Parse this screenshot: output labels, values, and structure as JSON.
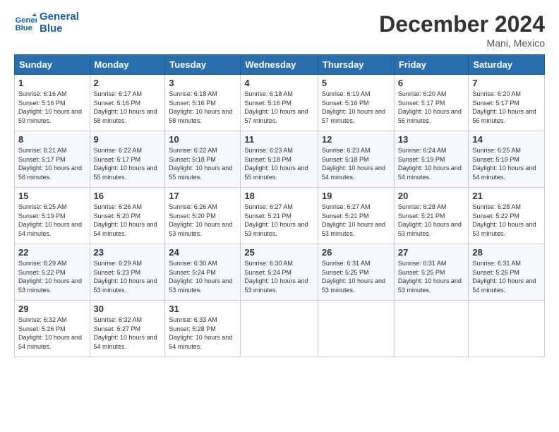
{
  "logo": {
    "line1": "General",
    "line2": "Blue"
  },
  "title": "December 2024",
  "location": "Mani, Mexico",
  "days_header": [
    "Sunday",
    "Monday",
    "Tuesday",
    "Wednesday",
    "Thursday",
    "Friday",
    "Saturday"
  ],
  "weeks": [
    [
      {
        "day": "1",
        "sunrise": "6:16 AM",
        "sunset": "5:16 PM",
        "daylight": "10 hours and 59 minutes."
      },
      {
        "day": "2",
        "sunrise": "6:17 AM",
        "sunset": "5:16 PM",
        "daylight": "10 hours and 58 minutes."
      },
      {
        "day": "3",
        "sunrise": "6:18 AM",
        "sunset": "5:16 PM",
        "daylight": "10 hours and 58 minutes."
      },
      {
        "day": "4",
        "sunrise": "6:18 AM",
        "sunset": "5:16 PM",
        "daylight": "10 hours and 57 minutes."
      },
      {
        "day": "5",
        "sunrise": "6:19 AM",
        "sunset": "5:16 PM",
        "daylight": "10 hours and 57 minutes."
      },
      {
        "day": "6",
        "sunrise": "6:20 AM",
        "sunset": "5:17 PM",
        "daylight": "10 hours and 56 minutes."
      },
      {
        "day": "7",
        "sunrise": "6:20 AM",
        "sunset": "5:17 PM",
        "daylight": "10 hours and 56 minutes."
      }
    ],
    [
      {
        "day": "8",
        "sunrise": "6:21 AM",
        "sunset": "5:17 PM",
        "daylight": "10 hours and 56 minutes."
      },
      {
        "day": "9",
        "sunrise": "6:22 AM",
        "sunset": "5:17 PM",
        "daylight": "10 hours and 55 minutes."
      },
      {
        "day": "10",
        "sunrise": "6:22 AM",
        "sunset": "5:18 PM",
        "daylight": "10 hours and 55 minutes."
      },
      {
        "day": "11",
        "sunrise": "6:23 AM",
        "sunset": "5:18 PM",
        "daylight": "10 hours and 55 minutes."
      },
      {
        "day": "12",
        "sunrise": "6:23 AM",
        "sunset": "5:18 PM",
        "daylight": "10 hours and 54 minutes."
      },
      {
        "day": "13",
        "sunrise": "6:24 AM",
        "sunset": "5:19 PM",
        "daylight": "10 hours and 54 minutes."
      },
      {
        "day": "14",
        "sunrise": "6:25 AM",
        "sunset": "5:19 PM",
        "daylight": "10 hours and 54 minutes."
      }
    ],
    [
      {
        "day": "15",
        "sunrise": "6:25 AM",
        "sunset": "5:19 PM",
        "daylight": "10 hours and 54 minutes."
      },
      {
        "day": "16",
        "sunrise": "6:26 AM",
        "sunset": "5:20 PM",
        "daylight": "10 hours and 54 minutes."
      },
      {
        "day": "17",
        "sunrise": "6:26 AM",
        "sunset": "5:20 PM",
        "daylight": "10 hours and 53 minutes."
      },
      {
        "day": "18",
        "sunrise": "6:27 AM",
        "sunset": "5:21 PM",
        "daylight": "10 hours and 53 minutes."
      },
      {
        "day": "19",
        "sunrise": "6:27 AM",
        "sunset": "5:21 PM",
        "daylight": "10 hours and 53 minutes."
      },
      {
        "day": "20",
        "sunrise": "6:28 AM",
        "sunset": "5:21 PM",
        "daylight": "10 hours and 53 minutes."
      },
      {
        "day": "21",
        "sunrise": "6:28 AM",
        "sunset": "5:22 PM",
        "daylight": "10 hours and 53 minutes."
      }
    ],
    [
      {
        "day": "22",
        "sunrise": "6:29 AM",
        "sunset": "5:22 PM",
        "daylight": "10 hours and 53 minutes."
      },
      {
        "day": "23",
        "sunrise": "6:29 AM",
        "sunset": "5:23 PM",
        "daylight": "10 hours and 53 minutes."
      },
      {
        "day": "24",
        "sunrise": "6:30 AM",
        "sunset": "5:24 PM",
        "daylight": "10 hours and 53 minutes."
      },
      {
        "day": "25",
        "sunrise": "6:30 AM",
        "sunset": "5:24 PM",
        "daylight": "10 hours and 53 minutes."
      },
      {
        "day": "26",
        "sunrise": "6:31 AM",
        "sunset": "5:25 PM",
        "daylight": "10 hours and 53 minutes."
      },
      {
        "day": "27",
        "sunrise": "6:31 AM",
        "sunset": "5:25 PM",
        "daylight": "10 hours and 53 minutes."
      },
      {
        "day": "28",
        "sunrise": "6:31 AM",
        "sunset": "5:26 PM",
        "daylight": "10 hours and 54 minutes."
      }
    ],
    [
      {
        "day": "29",
        "sunrise": "6:32 AM",
        "sunset": "5:26 PM",
        "daylight": "10 hours and 54 minutes."
      },
      {
        "day": "30",
        "sunrise": "6:32 AM",
        "sunset": "5:27 PM",
        "daylight": "10 hours and 54 minutes."
      },
      {
        "day": "31",
        "sunrise": "6:33 AM",
        "sunset": "5:28 PM",
        "daylight": "10 hours and 54 minutes."
      },
      null,
      null,
      null,
      null
    ]
  ]
}
